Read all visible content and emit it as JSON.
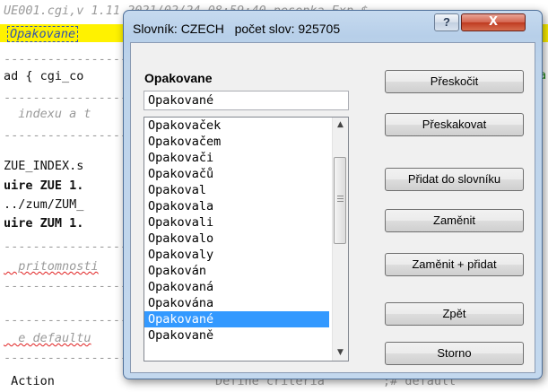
{
  "editor": {
    "lines": [
      {
        "text": "UE001.cgi,v 1.11 2021/02/24 08:59:40 pesenka Exp $",
        "style": "comment"
      },
      {
        "text": "  pakovane",
        "style": "plain"
      },
      {
        "text": "---------------------------------------------------------------------",
        "style": "dash"
      },
      {
        "text": "ad { cgi_co",
        "style": "plain"
      },
      {
        "text": "---------------------------------------------------------------------",
        "style": "dash"
      },
      {
        "text": "  indexu a t",
        "style": "comment"
      },
      {
        "text": "---------------------------------------------------------------------",
        "style": "dash"
      },
      {
        "text": "ZUE_INDEX.s",
        "style": "plain"
      },
      {
        "text": "uire ZUE 1.",
        "style": "require"
      },
      {
        "text": "../zum/ZUM_",
        "style": "plain"
      },
      {
        "text": "uire ZUM 1.",
        "style": "require"
      },
      {
        "text": "---------------------------------------------------------------------",
        "style": "dash"
      },
      {
        "text": "  pritomnosti",
        "style": "comment-wavy"
      },
      {
        "text": "---------------------------------------------------------------------",
        "style": "dash"
      },
      {
        "text": "---------------------------------------------------------------------",
        "style": "dash"
      },
      {
        "text": "",
        "style": "plain"
      },
      {
        "text": "  e defaultu",
        "style": "comment-wavy"
      },
      {
        "text": "---------------------------------------------------------------------",
        "style": "dash"
      },
      {
        "text": "",
        "style": "plain"
      },
      {
        "text": " Action",
        "style": "plain"
      }
    ],
    "highlighted_word": "Opakovane",
    "right_fragment_a": "a",
    "bottom_right_text": "Define criteria        ;# default"
  },
  "dialog": {
    "title": "Slovník: CZECH   počet slov: 925705",
    "help_label": "?",
    "close_label": "X",
    "word_label": "Opakovane",
    "replacement_value": "Opakované",
    "suggestions": [
      "Opakovaček",
      "Opakovačem",
      "Opakovači",
      "Opakovačů",
      "Opakoval",
      "Opakovala",
      "Opakovali",
      "Opakovalo",
      "Opakovaly",
      "Opakován",
      "Opakovaná",
      "Opakována",
      "Opakované",
      "Opakovaně"
    ],
    "selected_index": 12,
    "scroll_up_icon": "▲",
    "scroll_down_icon": "▼",
    "buttons": {
      "skip": "Přeskočit",
      "skip_all": "Přeskakovat",
      "add_to_dictionary": "Přidat do slovníku",
      "replace": "Zaměnit",
      "replace_and_add": "Zaměnit + přidat",
      "back": "Zpět",
      "cancel": "Storno"
    }
  },
  "colors": {
    "line_highlight": "#fff200",
    "selection": "#3399ff",
    "close_button": "#c7432a"
  }
}
